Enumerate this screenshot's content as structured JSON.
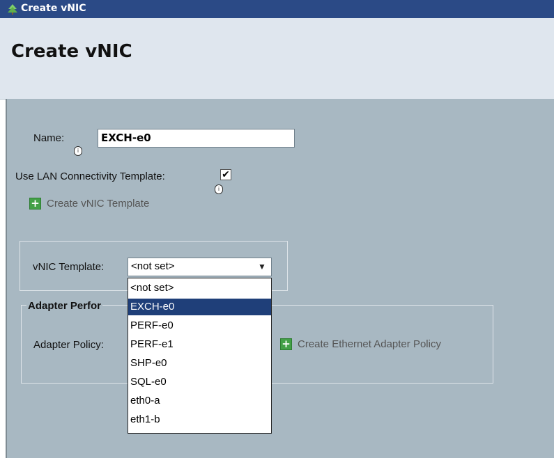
{
  "window": {
    "title": "Create vNIC"
  },
  "header": {
    "title": "Create vNIC"
  },
  "form": {
    "name_label": "Name:",
    "name_value": "EXCH-e0",
    "use_template_label": "Use LAN Connectivity Template:",
    "use_template_checked": true,
    "checkmark": "✔",
    "info_glyph": "i",
    "create_template_link": "Create vNIC Template",
    "vnic_template_label": "vNIC Template:",
    "vnic_template_value": "<not set>",
    "dropdown_arrow": "▼",
    "adapter_section_label": "Adapter Perfor",
    "adapter_policy_label": "Adapter Policy:",
    "create_adapter_policy_link": "Create Ethernet Adapter Policy",
    "plus_glyph": "+"
  },
  "dropdown": {
    "selected_index": 1,
    "options": [
      "<not set>",
      "EXCH-e0",
      "PERF-e0",
      "PERF-e1",
      "SHP-e0",
      "SQL-e0",
      "eth0-a",
      "eth1-b"
    ]
  },
  "colors": {
    "titlebar": "#2b4a86",
    "header_bg": "#dfe6ee",
    "panel_bg": "#a8b8c2",
    "selection": "#1f3f79",
    "plus_green": "#43a047"
  },
  "icons": {
    "window_icon": "ucs-tree-icon",
    "info": "info-icon",
    "add": "plus-icon",
    "dropdown": "chevron-down-icon"
  }
}
